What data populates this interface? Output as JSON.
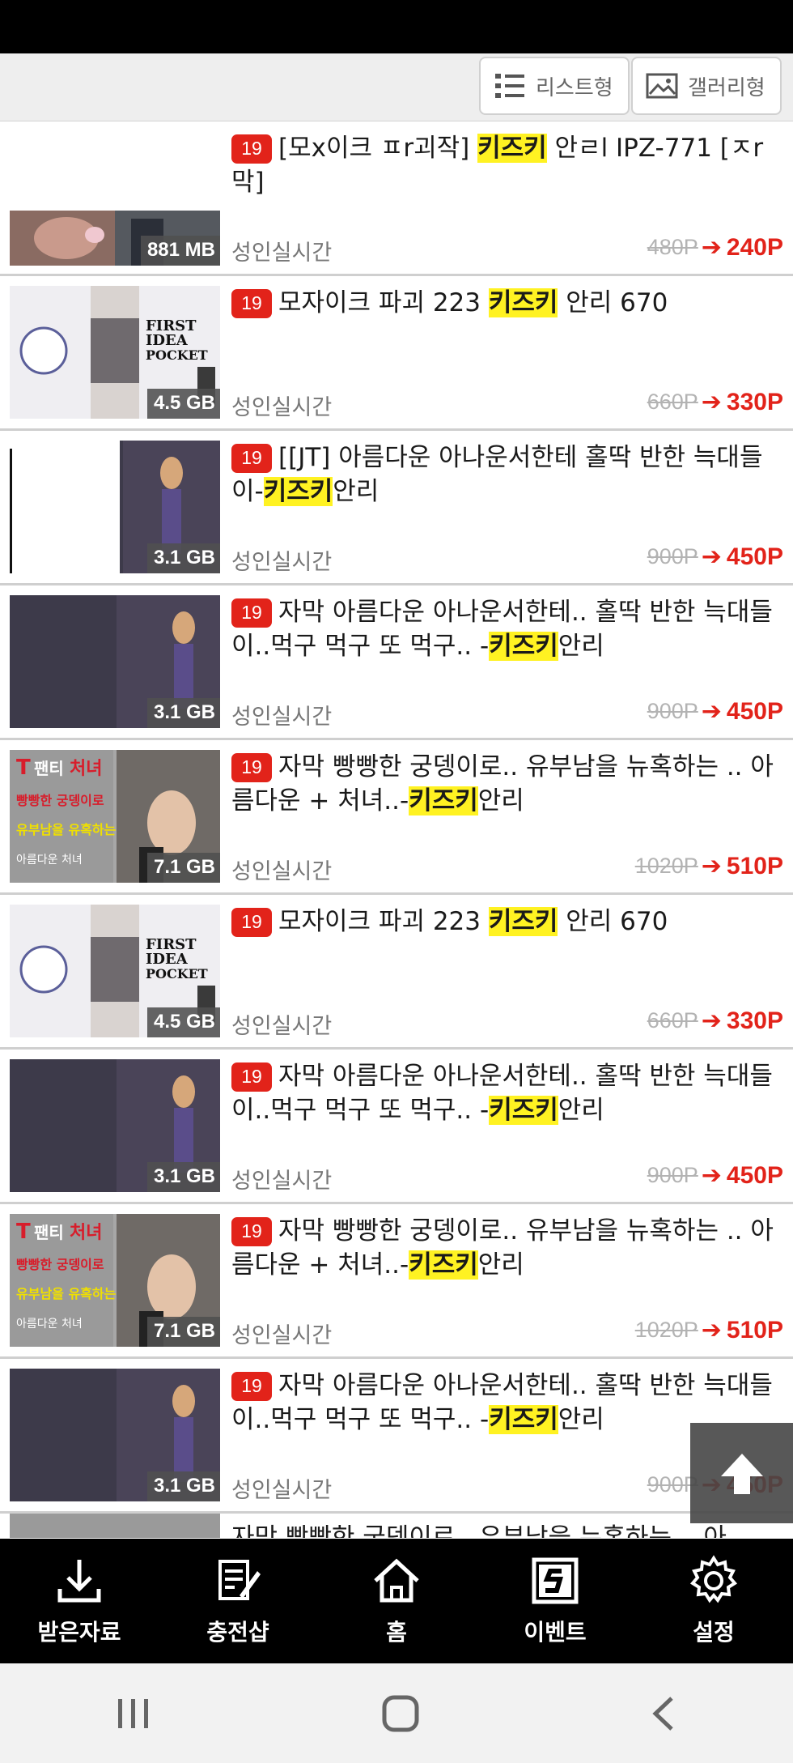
{
  "view_toggle": {
    "list_label": "리스트형",
    "gallery_label": "갤러리형"
  },
  "items": [
    {
      "title_pre": "[모x이크 ㅍr괴작] ",
      "title_hl": "키즈키",
      "title_post": " 안ㄹl IPZ-771 [ㅈr막]",
      "age": "19",
      "size": "881 MB",
      "category": "성인실시간",
      "orig_price": "480P",
      "sale_price": "240P"
    },
    {
      "title_pre": "모자이크 파괴 223 ",
      "title_hl": "키즈키",
      "title_post": " 안리 670",
      "age": "19",
      "size": "4.5 GB",
      "category": "성인실시간",
      "orig_price": "660P",
      "sale_price": "330P"
    },
    {
      "title_pre": "[[JT] 아름다운 아나운서한테 홀딱 반한 늑대들이-",
      "title_hl": "키즈키",
      "title_post": "안리",
      "age": "19",
      "size": "3.1 GB",
      "category": "성인실시간",
      "orig_price": "900P",
      "sale_price": "450P"
    },
    {
      "title_pre": "자막 아름다운 아나운서한테.. 홀딱 반한 늑대들이..먹구 먹구 또 먹구.. -",
      "title_hl": "키즈키",
      "title_post": "안리",
      "age": "19",
      "size": "3.1 GB",
      "category": "성인실시간",
      "orig_price": "900P",
      "sale_price": "450P"
    },
    {
      "title_pre": "자막 빵빵한 궁뎅이로.. 유부남을 뉴혹하는 .. 아름다운 + 처녀..-",
      "title_hl": "키즈키",
      "title_post": "안리",
      "age": "19",
      "size": "7.1 GB",
      "category": "성인실시간",
      "orig_price": "1020P",
      "sale_price": "510P"
    },
    {
      "title_pre": "모자이크 파괴 223 ",
      "title_hl": "키즈키",
      "title_post": " 안리 670",
      "age": "19",
      "size": "4.5 GB",
      "category": "성인실시간",
      "orig_price": "660P",
      "sale_price": "330P"
    },
    {
      "title_pre": "자막 아름다운 아나운서한테.. 홀딱 반한 늑대들이..먹구 먹구 또 먹구.. -",
      "title_hl": "키즈키",
      "title_post": "안리",
      "age": "19",
      "size": "3.1 GB",
      "category": "성인실시간",
      "orig_price": "900P",
      "sale_price": "450P"
    },
    {
      "title_pre": "자막 빵빵한 궁뎅이로.. 유부남을 뉴혹하는 .. 아름다운 + 처녀..-",
      "title_hl": "키즈키",
      "title_post": "안리",
      "age": "19",
      "size": "7.1 GB",
      "category": "성인실시간",
      "orig_price": "1020P",
      "sale_price": "510P"
    },
    {
      "title_pre": "자막 아름다운 아나운서한테.. 홀딱 반한 늑대들이..먹구 먹구 또 먹구.. -",
      "title_hl": "키즈키",
      "title_post": "안리",
      "age": "19",
      "size": "3.1 GB",
      "category": "성인실시간",
      "orig_price": "900P",
      "sale_price": "450P"
    }
  ],
  "partial_title": "자막 빵빵한 궁뎅이로.. 유부남을 뉴혹하는 .. 아",
  "bottom_nav": [
    {
      "label": "받은자료",
      "icon": "download-icon"
    },
    {
      "label": "충전샵",
      "icon": "edit-icon"
    },
    {
      "label": "홈",
      "icon": "home-icon"
    },
    {
      "label": "이벤트",
      "icon": "event-icon"
    },
    {
      "label": "설정",
      "icon": "gear-icon"
    }
  ],
  "thumb_styles": [
    "kiss",
    "pocket",
    "announcer-left",
    "announcer",
    "virgin",
    "pocket",
    "announcer",
    "virgin",
    "announcer"
  ],
  "colors": {
    "accent": "#e2231a",
    "highlight": "#fff222"
  }
}
